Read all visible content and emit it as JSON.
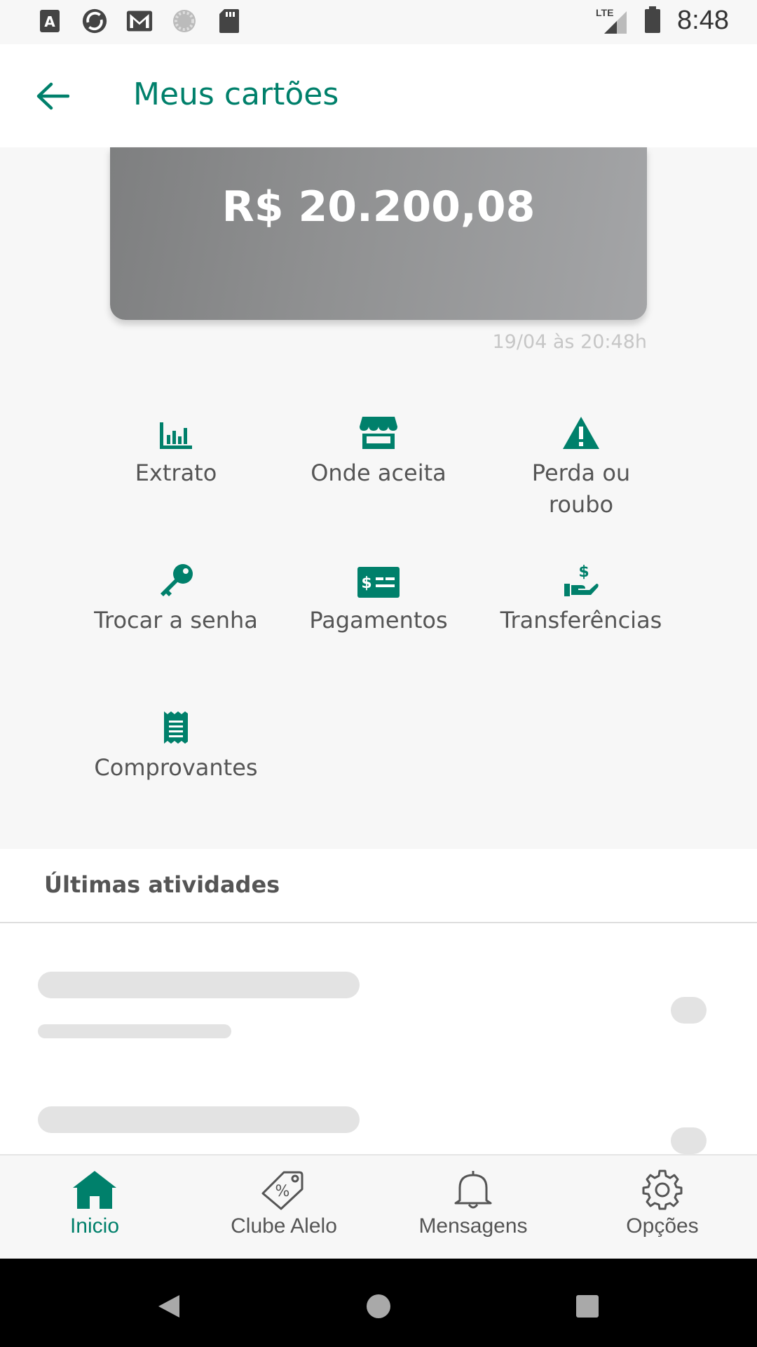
{
  "status_bar": {
    "time": "8:48",
    "network": "LTE"
  },
  "header": {
    "title": "Meus cartões"
  },
  "card": {
    "balance": "R$ 20.200,08",
    "updated": "19/04 às 20:48h"
  },
  "actions": [
    {
      "label": "Extrato",
      "icon": "bar-chart-icon"
    },
    {
      "label": "Onde aceita",
      "icon": "store-icon"
    },
    {
      "label": "Perda ou roubo",
      "icon": "warning-icon"
    },
    {
      "label": "Trocar a senha",
      "icon": "key-icon"
    },
    {
      "label": "Pagamentos",
      "icon": "payment-card-icon"
    },
    {
      "label": "Transferências",
      "icon": "hand-money-icon"
    },
    {
      "label": "Comprovantes",
      "icon": "receipt-icon"
    }
  ],
  "activities": {
    "title": "Últimas atividades"
  },
  "bottom_nav": {
    "items": [
      {
        "label": "Inicio",
        "icon": "home-icon",
        "active": true
      },
      {
        "label": "Clube Alelo",
        "icon": "discount-tag-icon",
        "active": false
      },
      {
        "label": "Mensagens",
        "icon": "bell-icon",
        "active": false
      },
      {
        "label": "Opções",
        "icon": "gear-icon",
        "active": false
      }
    ]
  },
  "colors": {
    "accent": "#00806b",
    "text": "#555555",
    "card_start": "#7e7f80",
    "card_end": "#a4a5a7"
  }
}
